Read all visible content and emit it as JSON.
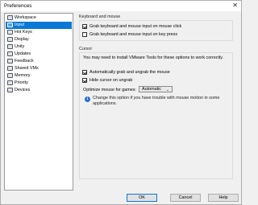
{
  "window": {
    "title": "Preferences",
    "close_glyph": "✕"
  },
  "sidebar": {
    "items": [
      {
        "label": "Workspace",
        "icon": "workspace-icon"
      },
      {
        "label": "Input",
        "icon": "keyboard-icon",
        "selected": true
      },
      {
        "label": "Hot Keys",
        "icon": "hotkeys-icon"
      },
      {
        "label": "Display",
        "icon": "display-icon"
      },
      {
        "label": "Unity",
        "icon": "unity-icon"
      },
      {
        "label": "Updates",
        "icon": "updates-icon"
      },
      {
        "label": "Feedback",
        "icon": "feedback-icon"
      },
      {
        "label": "Shared VMs",
        "icon": "shared-vms-icon"
      },
      {
        "label": "Memory",
        "icon": "memory-icon"
      },
      {
        "label": "Priority",
        "icon": "priority-icon"
      },
      {
        "label": "Devices",
        "icon": "devices-icon"
      }
    ]
  },
  "keyboard_mouse": {
    "title": "Keyboard and mouse",
    "grab_on_click": {
      "label": "Grab keyboard and mouse input on mouse click",
      "checked": true
    },
    "grab_on_key": {
      "label": "Grab keyboard and mouse input on key press",
      "checked": false
    }
  },
  "cursor": {
    "title": "Cursor",
    "message": "You may need to install VMware Tools for these options to work correctly.",
    "auto_grab": {
      "label": "Automatically grab and ungrab the mouse",
      "checked": true
    },
    "hide_cursor": {
      "label": "Hide cursor on ungrab",
      "checked": true
    },
    "optimize_label": "Optimize mouse for games:",
    "optimize_value": "Automatic",
    "info_glyph": "i",
    "note": "Change this option if you have trouble with mouse motion in some applications."
  },
  "buttons": {
    "ok": "OK",
    "cancel": "Cancel",
    "help": "Help"
  },
  "colors": {
    "selection": "#0a78d7",
    "info": "#2a6fd4"
  }
}
